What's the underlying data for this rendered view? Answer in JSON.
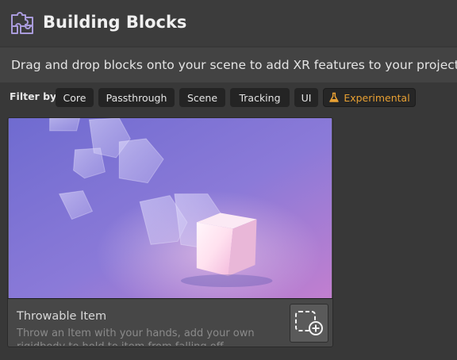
{
  "header": {
    "title": "Building Blocks",
    "icon": "puzzle-icon"
  },
  "subtitle": "Drag and drop blocks onto your scene to add XR features to your project.",
  "filters": {
    "label": "Filter by",
    "items": [
      {
        "label": "Core"
      },
      {
        "label": "Passthrough"
      },
      {
        "label": "Scene"
      },
      {
        "label": "Tracking"
      },
      {
        "label": "UI"
      },
      {
        "label": "Experimental",
        "icon": "flask-icon",
        "color": "#e8a033"
      }
    ]
  },
  "cards": [
    {
      "title": "Throwable Item",
      "description": "Throw an Item with your hands, add your own rigidbody to hold to item from falling off",
      "add_icon": "add-to-scene-icon"
    }
  ],
  "colors": {
    "accent": "#e8a033",
    "background": "#383838",
    "header": "#3c3c3c",
    "card": "#474747",
    "icon": "#a99bdb"
  }
}
